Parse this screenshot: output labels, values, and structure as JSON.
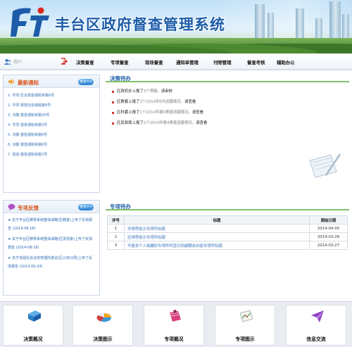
{
  "header": {
    "title": "丰台区政府督查管理系统"
  },
  "user": {
    "name": "用户"
  },
  "nav": [
    "决策督查",
    "专项督查",
    "现场督查",
    "通知单管理",
    "刊物管理",
    "督查考核",
    "辅助办公"
  ],
  "notices": {
    "title": "最新通知",
    "more": "更多>>",
    "items": [
      {
        "num": "1.",
        "text": "专项 区长督查通知单第6号"
      },
      {
        "num": "2.",
        "text": "专项 督查信息通报第6号"
      },
      {
        "num": "3.",
        "text": "决策 督查通知单第30号"
      },
      {
        "num": "4.",
        "text": "专项 督查通知单第5号"
      },
      {
        "num": "5.",
        "text": "决策 督查通知单第8号"
      },
      {
        "num": "6.",
        "text": "决策 督查通知单第8号"
      },
      {
        "num": "7.",
        "text": "其他 督查通知单第2号"
      }
    ]
  },
  "feedback": {
    "title": "专项反馈",
    "more": "更多>>",
    "items": [
      "★ 关于丰台区教育系统整体战略(区教委)上传了反馈报告 (2014-08-18)",
      "★ 关于丰台区教育系统整体战略(区发改委)上传了反馈报告 (2014-08-18)",
      "★ 关于加强社会治安管理的建议(区公安分局)上传了反馈报告 (2014-05-24)"
    ]
  },
  "decision_todo": {
    "title": "决策待办",
    "items": [
      {
        "pre": "区政府办上报了",
        "mid": "3个预案，",
        "post": "请审核"
      },
      {
        "pre": "区教委上报了",
        "mid": "3个2014年6月进展情况，",
        "post": "请查看"
      },
      {
        "pre": "区科委上报了",
        "mid": "1个2014年第4季度进展情况，",
        "post": "请查看"
      },
      {
        "pre": "区民政局上报了",
        "mid": "2个2014年第4季度进展情况，",
        "post": "请查看"
      }
    ]
  },
  "special_todo": {
    "title": "专项待办",
    "columns": [
      "序号",
      "标题",
      "期结日期"
    ],
    "rows": [
      {
        "no": "1",
        "title": "市领导批示专项件标题",
        "date": "2014-04-05"
      },
      {
        "no": "2",
        "title": "区领导批示专项件标题",
        "date": "2014-03-28"
      },
      {
        "no": "3",
        "title": "不是多个人收藏的专项件时显示的超期未办结专项件标题",
        "date": "2014-03-27"
      }
    ]
  },
  "footer": [
    "决策概况",
    "决策图示",
    "专项概况",
    "专项图示",
    "信息交流"
  ]
}
